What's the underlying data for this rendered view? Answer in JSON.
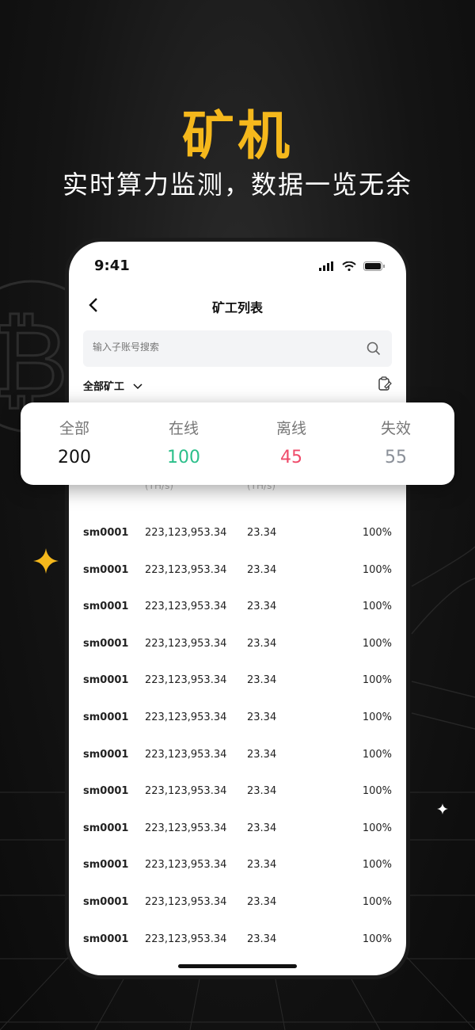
{
  "promo": {
    "headline": "矿机",
    "subline": "实时算力监测，数据一览无余"
  },
  "status_bar": {
    "time": "9:41"
  },
  "nav": {
    "title": "矿工列表"
  },
  "search": {
    "placeholder": "输入子账号搜索"
  },
  "filter": {
    "label": "全部矿工"
  },
  "summary": {
    "items": [
      {
        "label": "全部",
        "value": "200",
        "color": "#111111"
      },
      {
        "label": "在线",
        "value": "100",
        "color": "#2bbf8a"
      },
      {
        "label": "离线",
        "value": "45",
        "color": "#ef4b6a"
      },
      {
        "label": "失效",
        "value": "55",
        "color": "#8a8f98"
      }
    ]
  },
  "table": {
    "unit_col2": "(TH/s)",
    "unit_col3": "(TH/s)",
    "rows": [
      {
        "name": "sm0001",
        "rate": "223,123,953.34",
        "value": "23.34",
        "pct": "100%"
      },
      {
        "name": "sm0001",
        "rate": "223,123,953.34",
        "value": "23.34",
        "pct": "100%"
      },
      {
        "name": "sm0001",
        "rate": "223,123,953.34",
        "value": "23.34",
        "pct": "100%"
      },
      {
        "name": "sm0001",
        "rate": "223,123,953.34",
        "value": "23.34",
        "pct": "100%"
      },
      {
        "name": "sm0001",
        "rate": "223,123,953.34",
        "value": "23.34",
        "pct": "100%"
      },
      {
        "name": "sm0001",
        "rate": "223,123,953.34",
        "value": "23.34",
        "pct": "100%"
      },
      {
        "name": "sm0001",
        "rate": "223,123,953.34",
        "value": "23.34",
        "pct": "100%"
      },
      {
        "name": "sm0001",
        "rate": "223,123,953.34",
        "value": "23.34",
        "pct": "100%"
      },
      {
        "name": "sm0001",
        "rate": "223,123,953.34",
        "value": "23.34",
        "pct": "100%"
      },
      {
        "name": "sm0001",
        "rate": "223,123,953.34",
        "value": "23.34",
        "pct": "100%"
      },
      {
        "name": "sm0001",
        "rate": "223,123,953.34",
        "value": "23.34",
        "pct": "100%"
      },
      {
        "name": "sm0001",
        "rate": "223,123,953.34",
        "value": "23.34",
        "pct": "100%"
      }
    ]
  },
  "icons": [
    "back-arrow-icon",
    "search-icon",
    "edit-icon",
    "chevron-down-icon",
    "signal-icon",
    "wifi-icon",
    "battery-icon",
    "sparkle-icon",
    "bitcoin-icon"
  ]
}
